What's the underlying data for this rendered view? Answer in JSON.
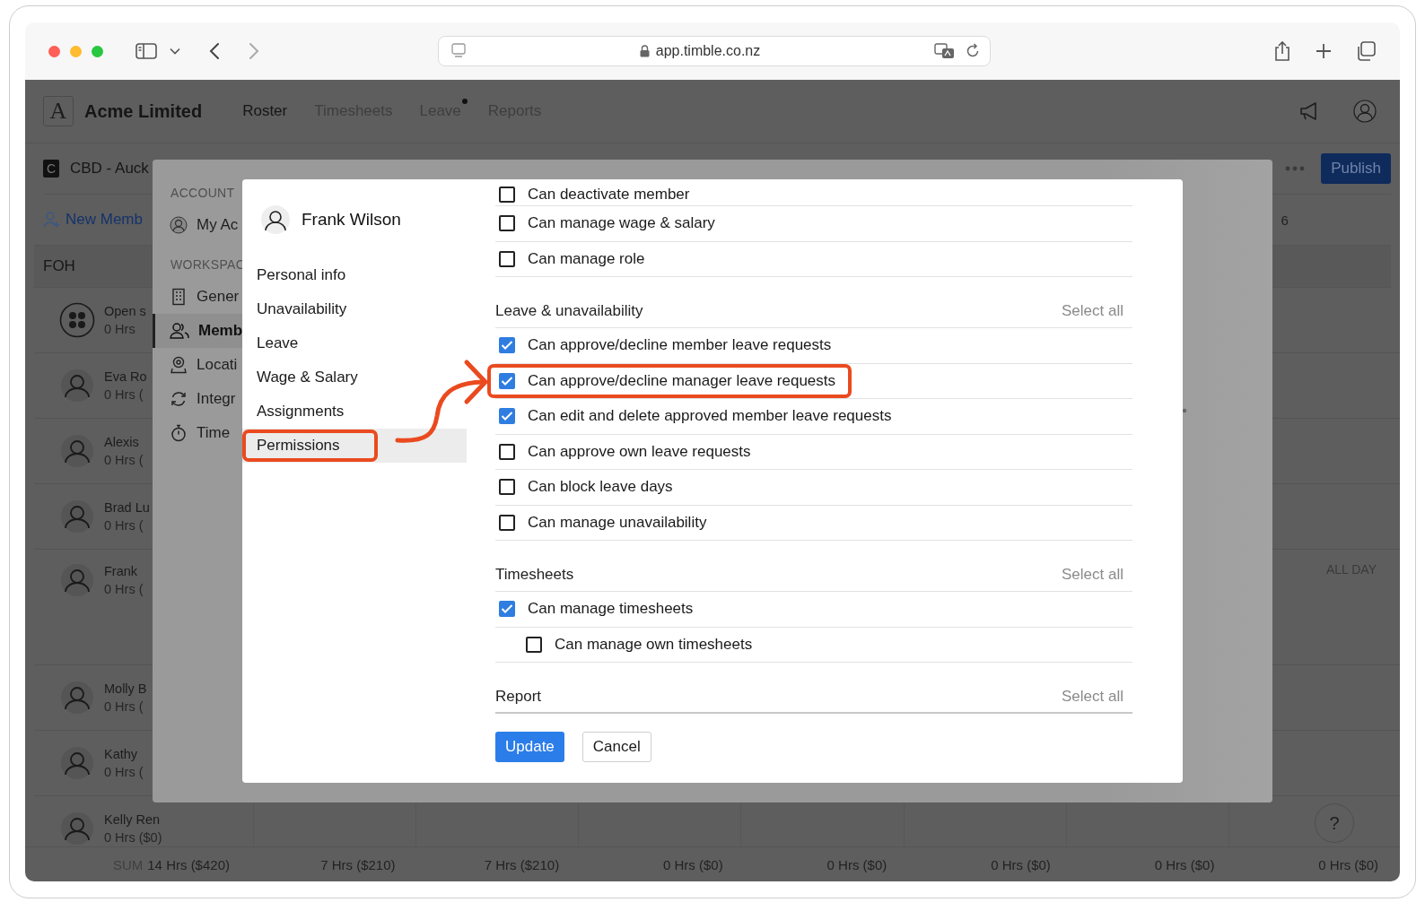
{
  "browser": {
    "url": "app.timble.co.nz"
  },
  "app": {
    "logo": "A",
    "org": "Acme Limited",
    "nav": [
      {
        "label": "Roster",
        "selected": true,
        "dot": false
      },
      {
        "label": "Timesheets",
        "selected": false,
        "dot": false
      },
      {
        "label": "Leave",
        "selected": false,
        "dot": true
      },
      {
        "label": "Reports",
        "selected": false,
        "dot": false
      }
    ]
  },
  "roster": {
    "location_badge": "C",
    "location": "CBD - Auck",
    "publish": "Publish",
    "new_member": "New Memb",
    "day_header": "6",
    "group": "FOH",
    "members": [
      {
        "kind": "open",
        "name": "Open s",
        "hours": "0 Hrs"
      },
      {
        "kind": "person",
        "name": "Eva Ro",
        "hours": "0 Hrs ("
      },
      {
        "kind": "person",
        "name": "Alexis",
        "hours": "0 Hrs ("
      },
      {
        "kind": "person",
        "name": "Brad Lu",
        "hours": "0 Hrs ("
      },
      {
        "kind": "person",
        "name": "Frank",
        "hours": "0 Hrs (",
        "all_day": "ALL DAY"
      },
      {
        "kind": "person",
        "name": "Molly B",
        "hours": "0 Hrs ("
      },
      {
        "kind": "person",
        "name": "Kathy",
        "hours": "0 Hrs ("
      },
      {
        "kind": "person",
        "name": "Kelly Ren",
        "hours": "0 Hrs ($0)"
      }
    ],
    "sum_label": "SUM",
    "totals": [
      "14 Hrs ($420)",
      "7 Hrs ($210)",
      "7 Hrs ($210)",
      "0 Hrs ($0)",
      "0 Hrs ($0)",
      "0 Hrs ($0)",
      "0 Hrs ($0)",
      "0 Hrs ($0)"
    ],
    "help": "?"
  },
  "settings": {
    "sections": [
      {
        "title": "ACCOUNT",
        "items": [
          {
            "kind": "avatar",
            "label": "My Ac",
            "selected": false
          }
        ]
      },
      {
        "title": "WORKSPAC",
        "items": [
          {
            "kind": "building",
            "label": "Gener",
            "selected": false
          },
          {
            "kind": "people",
            "label": "Memb",
            "selected": true
          },
          {
            "kind": "pin",
            "label": "Locati",
            "selected": false
          },
          {
            "kind": "sync",
            "label": "Integr",
            "selected": false
          },
          {
            "kind": "timer",
            "label": "Time",
            "selected": false
          }
        ]
      }
    ]
  },
  "member_dialog": {
    "name": "Frank Wilson",
    "nav": [
      {
        "label": "Personal info",
        "selected": false,
        "highlighted": false
      },
      {
        "label": "Unavailability",
        "selected": false,
        "highlighted": false
      },
      {
        "label": "Leave",
        "selected": false,
        "highlighted": false
      },
      {
        "label": "Wage & Salary",
        "selected": false,
        "highlighted": false
      },
      {
        "label": "Assignments",
        "selected": false,
        "highlighted": false
      },
      {
        "label": "Permissions",
        "selected": true,
        "highlighted": true
      }
    ],
    "groups": [
      {
        "permissions": [
          {
            "label": "Can deactivate member",
            "checked": false,
            "highlighted": false
          },
          {
            "label": "Can manage wage & salary",
            "checked": false,
            "highlighted": false
          },
          {
            "label": "Can manage role",
            "checked": false,
            "highlighted": false
          }
        ]
      },
      {
        "title": "Leave & unavailability",
        "select_all": "Select all",
        "permissions": [
          {
            "label": "Can approve/decline member leave requests",
            "checked": true,
            "highlighted": false
          },
          {
            "label": "Can approve/decline manager leave requests",
            "checked": true,
            "highlighted": true
          },
          {
            "label": "Can edit and delete approved member leave requests",
            "checked": true,
            "highlighted": false
          },
          {
            "label": "Can approve own leave requests",
            "checked": false,
            "highlighted": false
          },
          {
            "label": "Can block leave days",
            "checked": false,
            "highlighted": false
          },
          {
            "label": "Can manage unavailability",
            "checked": false,
            "highlighted": false
          }
        ]
      },
      {
        "title": "Timesheets",
        "select_all": "Select all",
        "permissions": [
          {
            "label": "Can manage timesheets",
            "checked": true,
            "highlighted": false,
            "children": [
              {
                "label": "Can manage own timesheets",
                "checked": false,
                "highlighted": false
              }
            ]
          }
        ]
      },
      {
        "title": "Report",
        "select_all": "Select all"
      }
    ],
    "buttons": {
      "primary": "Update",
      "secondary": "Cancel"
    }
  }
}
